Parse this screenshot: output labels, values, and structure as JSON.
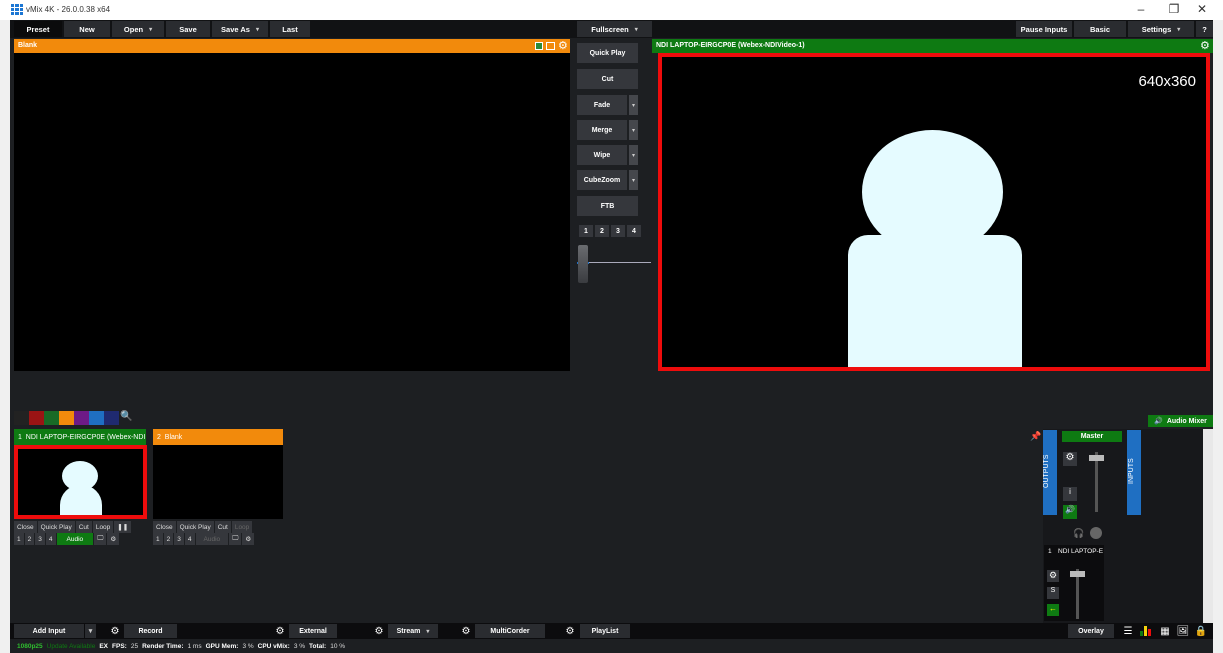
{
  "window": {
    "title": "vMix 4K - 26.0.0.38 x64",
    "minimize": "–",
    "maximize": "❐",
    "close": "✕"
  },
  "menu": {
    "preset": "Preset",
    "new": "New",
    "open": "Open",
    "save": "Save",
    "save_as": "Save As",
    "last": "Last",
    "fullscreen": "Fullscreen",
    "pause_inputs": "Pause Inputs",
    "basic": "Basic",
    "settings": "Settings",
    "help": "?"
  },
  "preview": {
    "label": "Blank"
  },
  "program": {
    "label": "NDI LAPTOP-EIRGCP0E (Webex-NDIVideo-1)",
    "resolution": "640x360"
  },
  "transitions": {
    "quick_play": "Quick Play",
    "cut": "Cut",
    "fade": "Fade",
    "merge": "Merge",
    "wipe": "Wipe",
    "cubezoom": "CubeZoom",
    "ftb": "FTB",
    "numbers": [
      "1",
      "2",
      "3",
      "4"
    ]
  },
  "inputs": [
    {
      "number": "1",
      "title": "NDI LAPTOP-EIRGCP0E (Webex-NDI",
      "controls": [
        "Close",
        "Quick Play",
        "Cut",
        "Loop"
      ],
      "overlays": [
        "1",
        "2",
        "3",
        "4"
      ],
      "audio": "Audio"
    },
    {
      "number": "2",
      "title": "Blank",
      "controls": [
        "Close",
        "Quick Play",
        "Cut",
        "Loop"
      ],
      "overlays": [
        "1",
        "2",
        "3",
        "4"
      ],
      "audio": "Audio"
    }
  ],
  "audio_mixer": {
    "button": "Audio Mixer",
    "master": "Master",
    "outputs": "OUTPUTS",
    "inputs": "INPUTS",
    "channel_number": "1",
    "channel_name": "NDI LAPTOP-E",
    "solo": "S"
  },
  "bottom": {
    "add_input": "Add Input",
    "record": "Record",
    "external": "External",
    "stream": "Stream",
    "multicorder": "MultiCorder",
    "playlist": "PlayList",
    "overlay": "Overlay"
  },
  "status": {
    "format": "1080p25",
    "update": "Update Available",
    "ex": "EX",
    "fps_label": "FPS:",
    "fps": "25",
    "render_label": "Render Time:",
    "render": "1 ms",
    "gpu_label": "GPU Mem:",
    "gpu": "3 %",
    "cpu_label": "CPU vMix:",
    "cpu": "3 %",
    "total_label": "Total:",
    "total": "10 %"
  },
  "colors": {
    "orange": "#f28a0c",
    "green": "#0e7a12",
    "red": "#ee0c0c",
    "blue": "#1f6fc2",
    "avatar": "#e5fbff"
  }
}
